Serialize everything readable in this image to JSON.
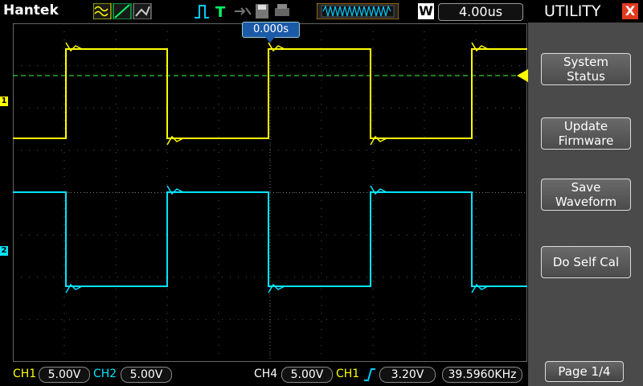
{
  "brand": "Hantek",
  "timebase": "4.00us",
  "trigger_position": "0.000s",
  "run_mode_label": "W",
  "panel": {
    "title": "UTILITY",
    "close_label": "X",
    "buttons": [
      {
        "label": "System\nStatus"
      },
      {
        "label": "Update\nFirmware"
      },
      {
        "label": "Save\nWaveform"
      },
      {
        "label": "Do Self Cal"
      }
    ],
    "page": "Page 1/4"
  },
  "channels": {
    "ch1": {
      "label": "CH1",
      "scale": "5.00V",
      "color": "#ffff00",
      "marker": "1"
    },
    "ch2": {
      "label": "CH2",
      "scale": "5.00V",
      "color": "#00e5ff",
      "marker": "2"
    },
    "ch4": {
      "label": "CH4",
      "scale": "5.00V",
      "color": "#ffffff"
    }
  },
  "trigger": {
    "source": "CH1",
    "level": "3.20V",
    "frequency": "39.5960KHz"
  },
  "colors": {
    "grid": "#555555",
    "panel": "#4a4a4a",
    "close": "#e03b1f"
  }
}
